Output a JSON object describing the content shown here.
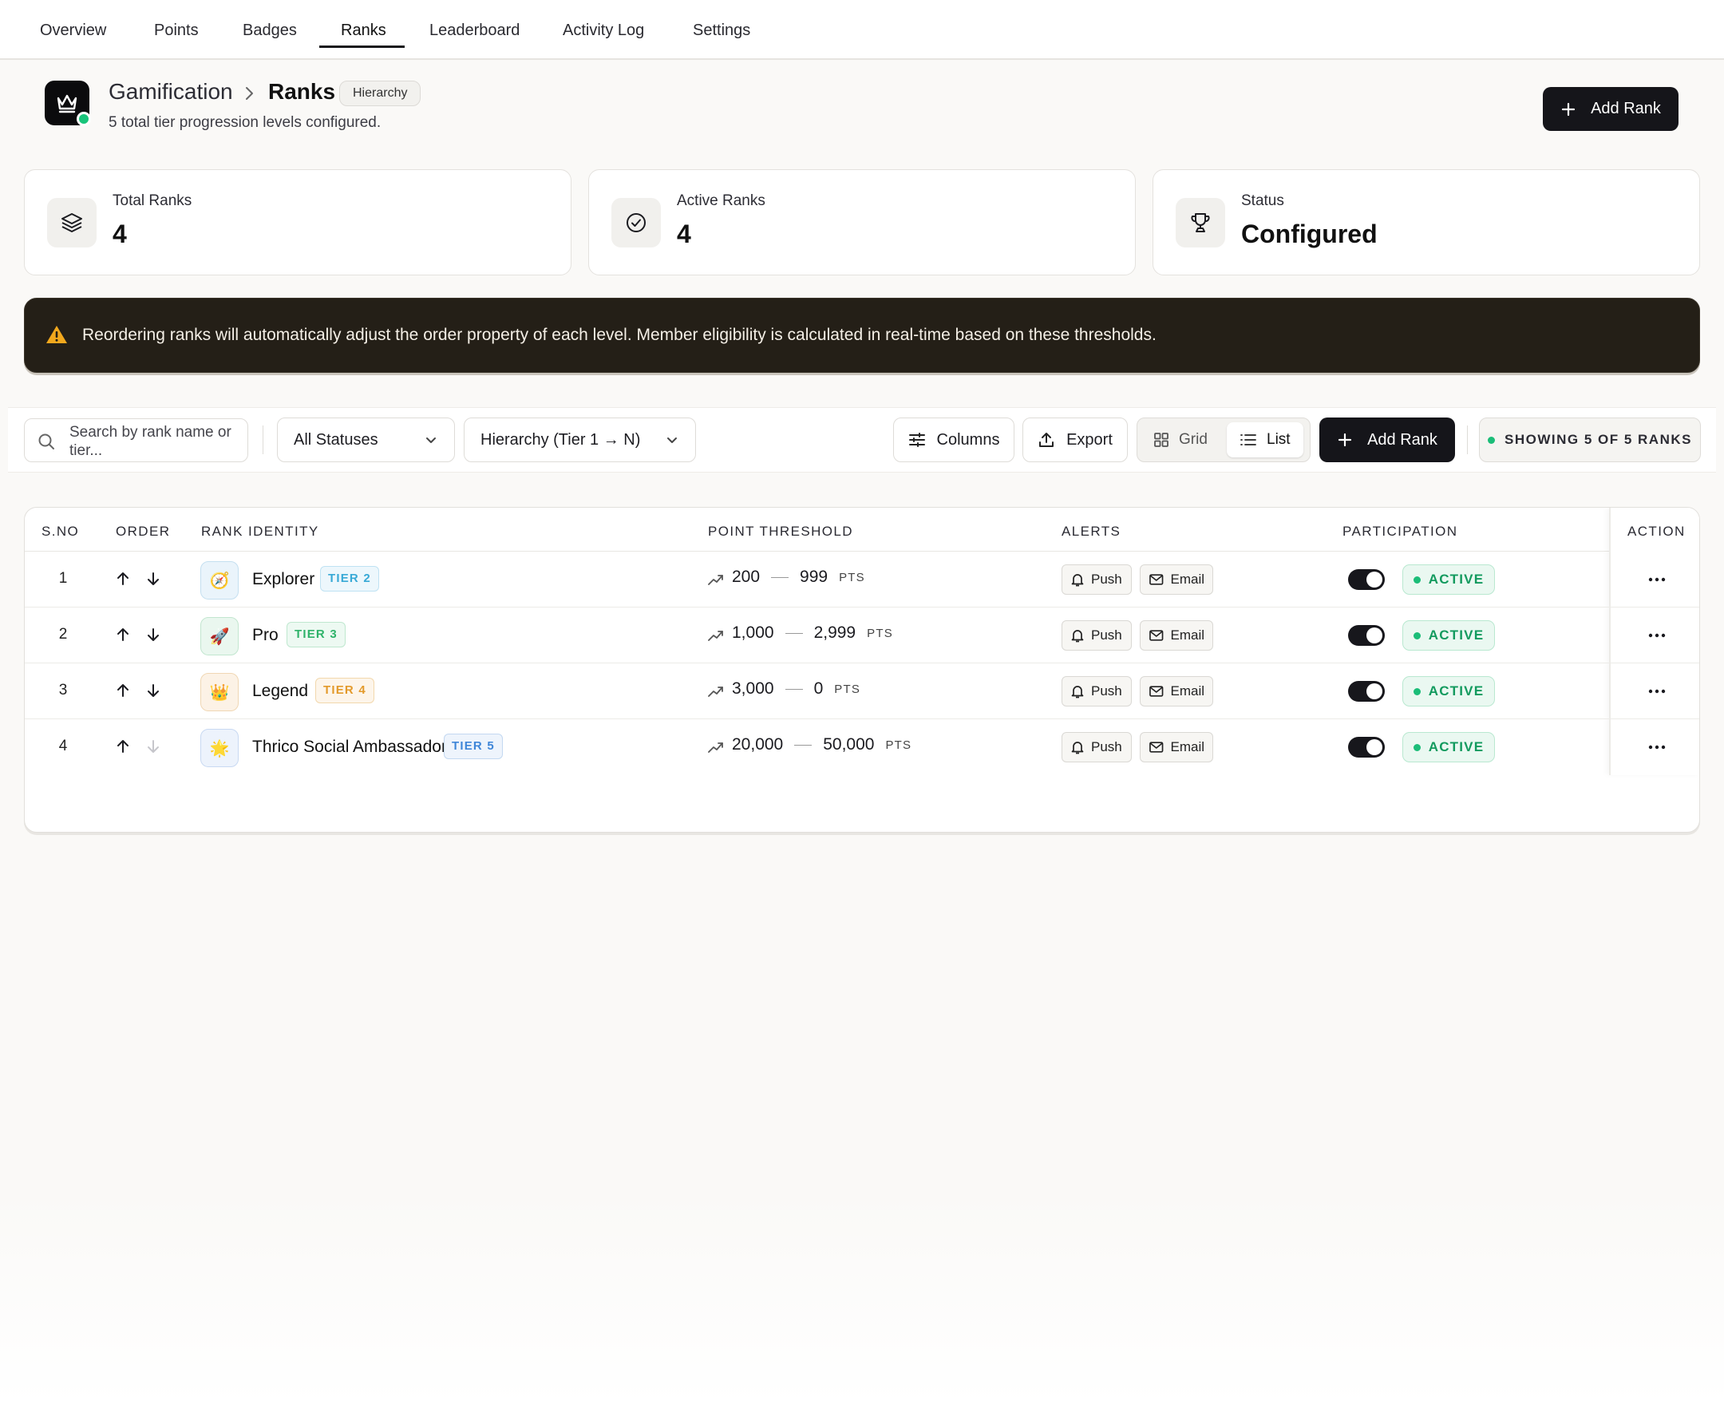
{
  "nav": {
    "tabs": [
      {
        "label": "Overview"
      },
      {
        "label": "Points"
      },
      {
        "label": "Badges"
      },
      {
        "label": "Ranks"
      },
      {
        "label": "Leaderboard"
      },
      {
        "label": "Activity Log"
      },
      {
        "label": "Settings"
      }
    ],
    "active_tab": "Ranks"
  },
  "header": {
    "breadcrumb_root": "Gamification",
    "breadcrumb_current": "Ranks",
    "badge": "Hierarchy",
    "subtitle": "5 total tier progression levels configured.",
    "add_button": "Add Rank",
    "icons": {
      "logo": "crown-icon",
      "separator": "chevron-right-icon",
      "add": "plus-icon"
    }
  },
  "stats": [
    {
      "label": "Total Ranks",
      "value": "4",
      "icon": "layers-icon"
    },
    {
      "label": "Active Ranks",
      "value": "4",
      "icon": "check-circle-icon"
    },
    {
      "label": "Status",
      "value": "Configured",
      "icon": "trophy-icon"
    }
  ],
  "banner": {
    "text": "Reordering ranks will automatically adjust the order property of each level. Member eligibility is calculated in real-time based on these thresholds.",
    "icon": "warning-icon"
  },
  "toolbar": {
    "search_placeholder": "Search by rank name or tier...",
    "status_filter": "All Statuses",
    "order_filter": "Hierarchy (Tier 1 → N)",
    "columns_label": "Columns",
    "export_label": "Export",
    "view_grid": "Grid",
    "view_list": "List",
    "active_view": "List",
    "add_label": "Add Rank",
    "showing": "SHOWING 5 OF 5 RANKS"
  },
  "table": {
    "headers": {
      "sno": "S.NO",
      "order": "ORDER",
      "identity": "RANK IDENTITY",
      "threshold": "POINT THRESHOLD",
      "alerts": "ALERTS",
      "participation": "PARTICIPATION",
      "action": "ACTION"
    },
    "push_label": "Push",
    "email_label": "Email",
    "unit": "PTS",
    "rows": [
      {
        "sno": "1",
        "name": "Explorer",
        "tier": "TIER 2",
        "emoji": "🧭",
        "min": "200",
        "max": "999",
        "status": "ACTIVE",
        "down_enabled": true
      },
      {
        "sno": "2",
        "name": "Pro",
        "tier": "TIER 3",
        "emoji": "🚀",
        "min": "1,000",
        "max": "2,999",
        "status": "ACTIVE",
        "down_enabled": true
      },
      {
        "sno": "3",
        "name": "Legend",
        "tier": "TIER 4",
        "emoji": "👑",
        "min": "3,000",
        "max": "0",
        "status": "ACTIVE",
        "down_enabled": true
      },
      {
        "sno": "4",
        "name": "Thrico Social Ambassador",
        "tier": "TIER 5",
        "emoji": "🌟",
        "min": "20,000",
        "max": "50,000",
        "status": "ACTIVE",
        "down_enabled": false
      }
    ]
  },
  "colors": {
    "primary": "#15151a",
    "banner_bg": "#241f17",
    "warning": "#f2a81d",
    "success": "#129a5e",
    "tier2": "#38a9d6",
    "tier3": "#2fb36a",
    "tier4": "#e39a2b",
    "tier5": "#3f86d8"
  }
}
